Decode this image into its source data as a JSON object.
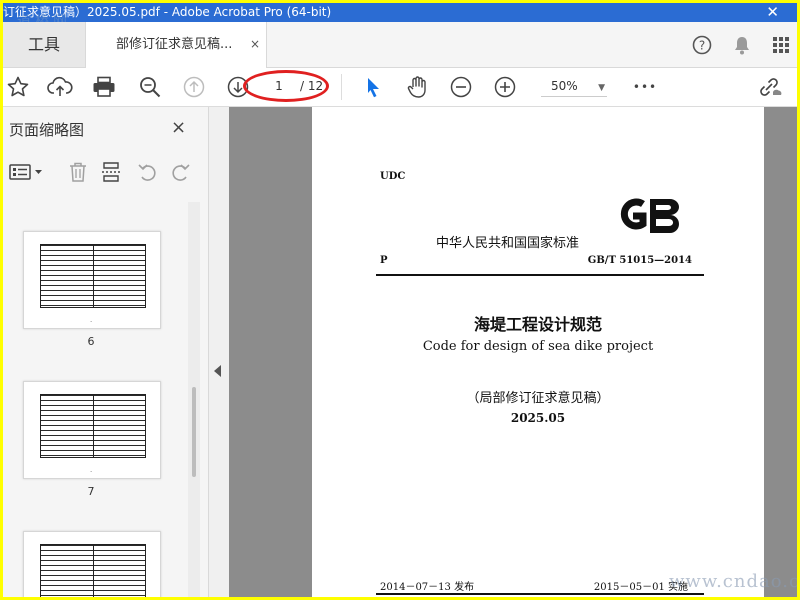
{
  "window": {
    "title": "订征求意见稿）2025.05.pdf - Adobe Acrobat Pro (64-bit)",
    "close": "✕"
  },
  "watermark": {
    "top": "道桥网",
    "bottom": "www.cndao.c"
  },
  "tabs": {
    "tools": "工具",
    "doc": "部修订征求意见稿...",
    "doc_close": "×"
  },
  "toolbar": {
    "page_current": "1",
    "page_total": "/ 12",
    "zoom": "50%",
    "more": "•••"
  },
  "sidebar": {
    "title": "页面缩略图",
    "close": "×",
    "thumbnails": [
      {
        "label": "6"
      },
      {
        "label": "7"
      },
      {
        "label": ""
      }
    ]
  },
  "document": {
    "udc": "UDC",
    "standard_name": "中华人民共和国国家标准",
    "logo": "GB",
    "p_label": "P",
    "code": "GB/T 51015—2014",
    "title_zh": "海堤工程设计规范",
    "title_en": "Code for design of sea dike project",
    "draft_note": "（局部修订征求意见稿）",
    "draft_date": "2025.05",
    "publish": "2014－07－13 发布",
    "implement": "2015－05－01 实施"
  },
  "colors": {
    "titlebar": "#2b6cd3",
    "border": "#ffff00",
    "annotation": "#e02020",
    "select_tool": "#1473e6"
  }
}
